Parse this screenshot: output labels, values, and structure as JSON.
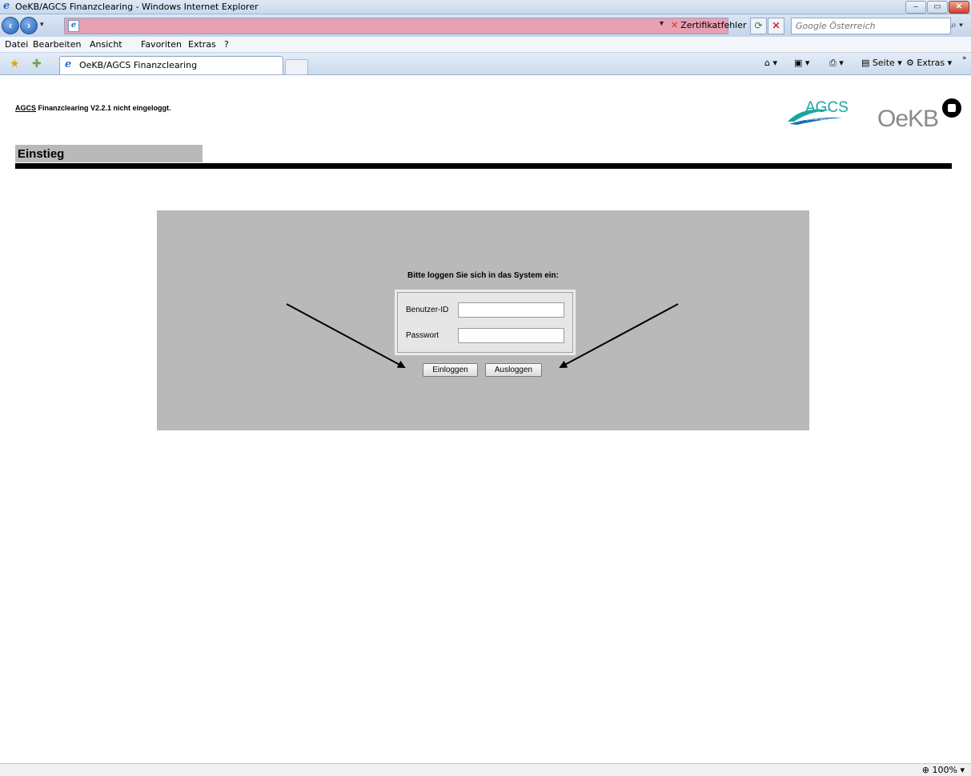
{
  "window": {
    "title": "OeKB/AGCS Finanzclearing - Windows Internet Explorer",
    "controls": {
      "minimize": "–",
      "maximize": "▭",
      "close": "✕"
    }
  },
  "addressbar": {
    "url": "",
    "certificate_warning": "Zertifikatfehler",
    "search_placeholder": "Google Österreich"
  },
  "menu": {
    "items": [
      "Datei",
      "Bearbeiten",
      "Ansicht",
      "Favoriten",
      "Extras",
      "?"
    ]
  },
  "tabs": {
    "active_tab": "OeKB/AGCS Finanzclearing"
  },
  "commandbar": {
    "page": "Seite",
    "extras": "Extras"
  },
  "page": {
    "status_app": "AGCS",
    "status_text": " Finanzclearing V2.2.1 nicht eingeloggt.",
    "logo_agcs": "AGCS",
    "logo_agcs_tagline": "mitglied der oekb gruppe",
    "logo_oekb": "OeKB",
    "section_title": "Einstieg",
    "login": {
      "prompt": "Bitte loggen Sie sich in das System ein:",
      "user_label": "Benutzer-ID",
      "user_value": "",
      "password_label": "Passwort",
      "password_value": "",
      "login_button": "Einloggen",
      "logout_button": "Ausloggen"
    }
  },
  "statusbar": {
    "zoom": "100%"
  },
  "colors": {
    "panel_gray": "#b9b9b9",
    "agcs_teal": "#1aa6a0",
    "agcs_blue": "#1b6fb5",
    "oekb_gray": "#8a8a8a",
    "address_bar_error": "#e8a0b3"
  }
}
